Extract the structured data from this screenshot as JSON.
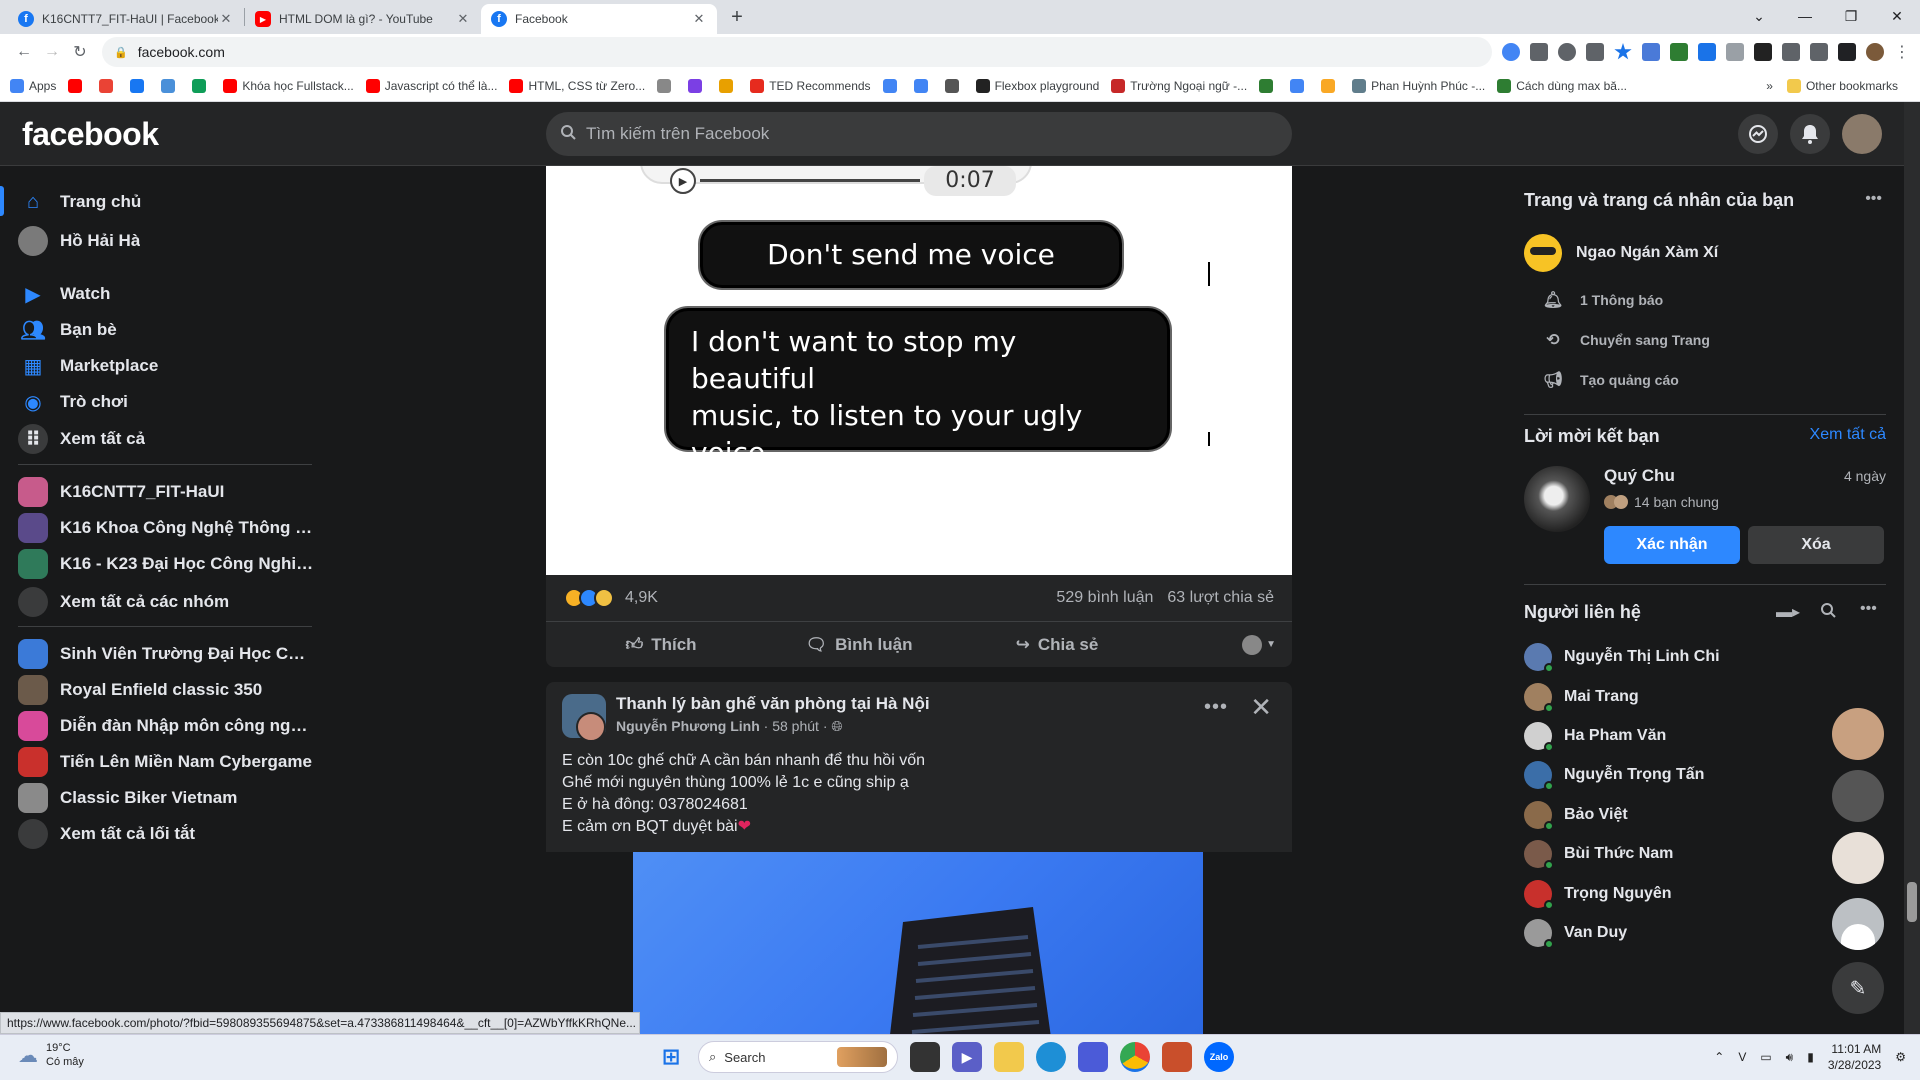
{
  "browser": {
    "tabs": [
      {
        "title": "K16CNTT7_FIT-HaUI | Facebook",
        "favicon": "facebook-icon",
        "color": "#1877f2",
        "active": false
      },
      {
        "title": "HTML DOM là gì? - YouTube",
        "favicon": "youtube-icon",
        "color": "#ff0000",
        "active": false
      },
      {
        "title": "Facebook",
        "favicon": "facebook-icon",
        "color": "#1877f2",
        "active": true
      }
    ],
    "new_tab": "+",
    "url": "facebook.com",
    "bookmarks": [
      {
        "label": "Apps",
        "color": "#4285f4"
      },
      {
        "label": "",
        "color": "#ff0000"
      },
      {
        "label": "",
        "color": "#ea4335"
      },
      {
        "label": "",
        "color": "#1877f2"
      },
      {
        "label": "",
        "color": "#4a90d9"
      },
      {
        "label": "",
        "color": "#0f9d58"
      },
      {
        "label": "Khóa học Fullstack...",
        "color": "#ff0000"
      },
      {
        "label": "Javascript có thể là...",
        "color": "#ff0000"
      },
      {
        "label": "HTML, CSS từ Zero...",
        "color": "#ff0000"
      },
      {
        "label": "",
        "color": "#888"
      },
      {
        "label": "",
        "color": "#7b3fe4"
      },
      {
        "label": "",
        "color": "#e8a000"
      },
      {
        "label": "TED Recommends",
        "color": "#e62b1e"
      },
      {
        "label": "",
        "color": "#4285f4"
      },
      {
        "label": "",
        "color": "#4285f4"
      },
      {
        "label": "",
        "color": "#555"
      },
      {
        "label": "Flexbox playground",
        "color": "#222"
      },
      {
        "label": "Trường Ngoại ngữ -...",
        "color": "#c62828"
      },
      {
        "label": "",
        "color": "#2e7d32"
      },
      {
        "label": "",
        "color": "#4285f4"
      },
      {
        "label": "",
        "color": "#f9a825"
      },
      {
        "label": "Phan Huỳnh Phúc -...",
        "color": "#607d8b"
      },
      {
        "label": "Cách dùng max bă...",
        "color": "#2e7d32"
      }
    ],
    "more_bookmarks": "»",
    "other_bookmarks": "Other bookmarks",
    "status_url": "https://www.facebook.com/photo/?fbid=598089355694875&set=a.473386811498464&__cft__[0]=AZWbYffkKRhQNe..."
  },
  "header": {
    "logo": "facebook",
    "search_placeholder": "Tìm kiếm trên Facebook"
  },
  "left_nav": {
    "main": [
      {
        "label": "Trang chủ",
        "icon": "home-icon",
        "color": "#2d88ff"
      },
      {
        "label": "Hồ Hải Hà",
        "icon": "avatar",
        "color": "#7a7a7a"
      },
      {
        "label": "Watch",
        "icon": "watch-icon",
        "color": "#2d88ff"
      },
      {
        "label": "Bạn bè",
        "icon": "friends-icon",
        "color": "#2d88ff"
      },
      {
        "label": "Marketplace",
        "icon": "marketplace-icon",
        "color": "#2d88ff"
      },
      {
        "label": "Trò chơi",
        "icon": "gaming-icon",
        "color": "#2d88ff"
      },
      {
        "label": "Xem tất cả",
        "icon": "grid-icon",
        "color": "#3a3b3c"
      }
    ],
    "groups": [
      {
        "label": "K16CNTT7_FIT-HaUI",
        "color": "#c75b8b"
      },
      {
        "label": "K16 Khoa Công Nghệ Thông Ti...",
        "color": "#5a4a8a"
      },
      {
        "label": "K16 - K23 Đại Học Công Nghiệ...",
        "color": "#2f7a5a"
      },
      {
        "label": "Xem tất cả các nhóm",
        "color": "#3a3b3c"
      }
    ],
    "shortcuts": [
      {
        "label": "Sinh Viên Trường Đại Học Công...",
        "color": "#3b7ad8"
      },
      {
        "label": "Royal Enfield classic 350",
        "color": "#6b5a4a"
      },
      {
        "label": "Diễn đàn Nhập môn công nghệ...",
        "color": "#d84a9a"
      },
      {
        "label": "Tiến Lên Miền Nam Cybergame",
        "color": "#c9302c"
      },
      {
        "label": "Classic Biker Vietnam",
        "color": "#8a8a8a"
      },
      {
        "label": "Xem tất cả lối tắt",
        "color": "#3a3b3c"
      }
    ]
  },
  "feed": {
    "meme": {
      "audio_time": "0:07",
      "bubble1": "Don't send me voice messages",
      "bubble2_lines": [
        "I don't want to stop my beautiful",
        "music, to listen to your ugly",
        "voice."
      ]
    },
    "post1_stats": {
      "reactions": "4,9K",
      "comments": "529 bình luận",
      "shares": "63 lượt chia sẻ"
    },
    "actions": {
      "like": "Thích",
      "comment": "Bình luận",
      "share": "Chia sẻ"
    },
    "post2": {
      "group": "Thanh lý bàn ghế văn phòng tại Hà Nội",
      "author": "Nguyễn Phương Linh",
      "time": "58 phút",
      "lines": [
        "E còn 10c ghế chữ A cần bán nhanh để thu hồi vốn",
        "Ghế mới nguyên thùng 100% lẻ 1c e cũng ship ạ",
        "E ở hà đông: 0378024681",
        "E cảm ơn BQT duyệt bài"
      ]
    }
  },
  "right": {
    "pages_title": "Trang và trang cá nhân của bạn",
    "page_name": "Ngao Ngán Xàm Xí",
    "page_actions": [
      {
        "label": "1 Thông báo",
        "icon": "bell-icon"
      },
      {
        "label": "Chuyển sang Trang",
        "icon": "switch-profile-icon"
      },
      {
        "label": "Tạo quảng cáo",
        "icon": "megaphone-icon"
      }
    ],
    "friend_requests_title": "Lời mời kết bạn",
    "see_all": "Xem tất cả",
    "request": {
      "name": "Quý Chu",
      "time": "4 ngày",
      "mutual": "14 bạn chung",
      "confirm": "Xác nhận",
      "delete": "Xóa"
    },
    "contacts_title": "Người liên hệ",
    "contacts": [
      {
        "name": "Nguyễn Thị Linh Chi",
        "color": "#5a7ab0"
      },
      {
        "name": "Mai Trang",
        "color": "#a08060"
      },
      {
        "name": "Ha Pham Văn",
        "color": "#d0d0d0"
      },
      {
        "name": "Nguyễn Trọng Tấn",
        "color": "#3b6ea8"
      },
      {
        "name": "Bảo Việt",
        "color": "#8a6a4a"
      },
      {
        "name": "Bùi Thức Nam",
        "color": "#7a5a4a"
      },
      {
        "name": "Trọng Nguyên",
        "color": "#c8302c"
      },
      {
        "name": "Van Duy",
        "color": "#9a9a9a"
      }
    ]
  },
  "taskbar": {
    "temperature": "19°C",
    "weather": "Có mây",
    "search": "Search",
    "time": "11:01 AM",
    "date": "3/28/2023"
  }
}
